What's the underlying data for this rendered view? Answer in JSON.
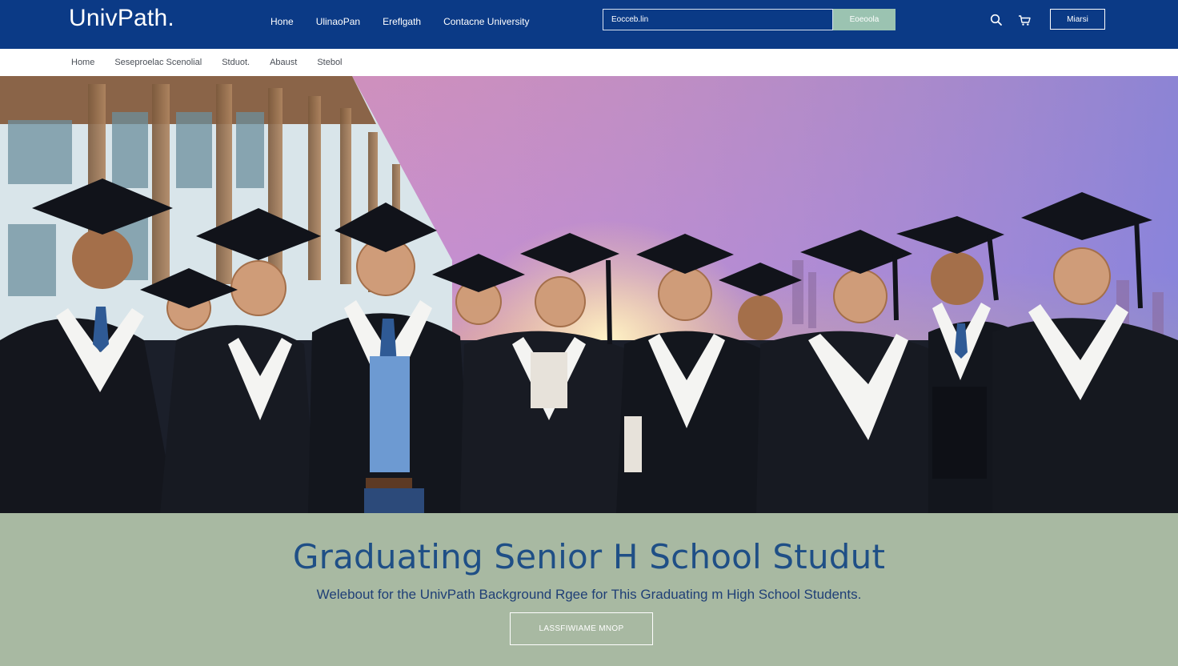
{
  "header": {
    "logo": "UnivPath.",
    "nav": [
      "Hone",
      "UlinaoPan",
      "Ereflgath",
      "Contacne University"
    ],
    "search": {
      "placeholder": "Eocceb.lin",
      "button_label": "Eoeoola"
    },
    "icons": [
      "search-icon",
      "cart-icon"
    ],
    "login_label": "Miarsi"
  },
  "subnav": {
    "items": [
      "Home",
      "Seseproelac Scenolial",
      "Stduot.",
      "Abaust",
      "Stebol"
    ]
  },
  "hero": {
    "image": "graduating-students-photo"
  },
  "content": {
    "headline": "Graduating Senior H School Studut",
    "subheadline": "Welebout for the UnivPath Background Rgee  for This Graduating m High School Students.",
    "cta_label": "LASSFIWIAME MNOP"
  },
  "colors": {
    "navy": "#0b3a86",
    "sage": "#a8b9a2",
    "headline": "#1f4f86"
  }
}
